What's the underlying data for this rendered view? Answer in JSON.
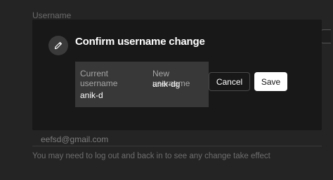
{
  "background": {
    "field_label": "Username",
    "email_value": "eefsd@gmail.com",
    "hint": "You may need to log out and back in to see any change take effect"
  },
  "modal": {
    "title": "Confirm username change",
    "icon": "pencil-icon",
    "current_label_line1": "Current",
    "current_label_line2": "username",
    "current_value": "anik-d",
    "new_label": "New username",
    "new_value": "anik-dg",
    "cancel_label": "Cancel",
    "save_label": "Save"
  },
  "colors": {
    "page_bg": "#242424",
    "modal_bg": "#181818",
    "info_box_bg": "#383838",
    "primary_button_bg": "#ffffff"
  }
}
